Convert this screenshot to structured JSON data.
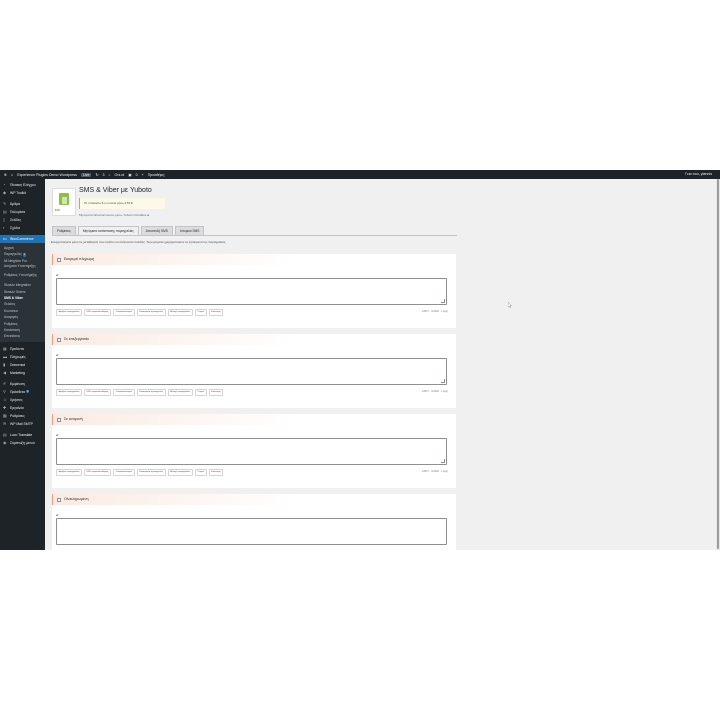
{
  "adminbar": {
    "site_name": "Experience Plugins Demo Wordpress",
    "site_badge": "Live",
    "updates_count": "3",
    "clear_label": "Οτε.ιά",
    "comments_count": "0",
    "new_label": "Προσθήκη",
    "greeting": "Γεια σου, yiannis"
  },
  "sidebar": {
    "top_items": [
      {
        "label": "Πίνακας Ελέγχου",
        "icon": "dashboard-icon"
      },
      {
        "label": "WP Toolkit",
        "icon": "toolkit-icon"
      }
    ],
    "content_items": [
      {
        "label": "Άρθρα",
        "icon": "pin-icon"
      },
      {
        "label": "Πολυμέσα",
        "icon": "media-icon"
      },
      {
        "label": "Σελίδες",
        "icon": "pages-icon"
      },
      {
        "label": "Σχόλια",
        "icon": "comments-icon"
      }
    ],
    "woocommerce_label": "WooCommerce",
    "woo_sub": [
      {
        "label": "Αρχική",
        "current": false
      },
      {
        "label": "Παραγγελίες",
        "badge": "1",
        "current": false
      },
      {
        "label": "Mi Neighbor Pro",
        "current": false
      },
      {
        "label": "Αιτήματα Υποστήριξης",
        "current": false
      },
      {
        "label": "Ρυθμίσεις Υποστήριξης",
        "current": false
      },
      {
        "label": "Skroutz Integration",
        "current": false
      },
      {
        "label": "Skroutz Orders",
        "current": false
      },
      {
        "label": "SMS & Viber",
        "current": true
      },
      {
        "label": "Πελάτες",
        "current": false
      },
      {
        "label": "Κουπόνια",
        "current": false
      },
      {
        "label": "Αναφορές",
        "current": false
      },
      {
        "label": "Ρυθμίσεις",
        "current": false
      },
      {
        "label": "Κατάσταση",
        "current": false
      },
      {
        "label": "Επεκτάσεις",
        "current": false
      }
    ],
    "shop_items": [
      {
        "label": "Προϊόντα",
        "icon": "products-icon"
      },
      {
        "label": "Πληρωμές",
        "icon": "payments-icon"
      },
      {
        "label": "Στατιστικά",
        "icon": "analytics-icon"
      },
      {
        "label": "Marketing",
        "icon": "megaphone-icon"
      }
    ],
    "tool_items": [
      {
        "label": "Εμφάνιση",
        "icon": "brush-icon"
      },
      {
        "label": "Πρόσθετα",
        "icon": "plugin-icon",
        "badge": "3"
      },
      {
        "label": "Χρήστες",
        "icon": "users-icon"
      },
      {
        "label": "Εργαλεία",
        "icon": "wrench-icon"
      },
      {
        "label": "Ρυθμίσεις",
        "icon": "settings-icon"
      },
      {
        "label": "WP Mail SMTP",
        "icon": "mail-icon"
      }
    ],
    "bottom_items": [
      {
        "label": "Loco Translate",
        "icon": "translate-icon"
      },
      {
        "label": "Σύμπτυξη μενού",
        "icon": "collapse-icon"
      }
    ]
  },
  "page": {
    "title": "SMS & Viber με Yuboto",
    "notice": "Το υπόλοιπο δ.ν.ευ είναι μόνο 4.53 €",
    "subtext": "Μηνύματα WooCommerce μέσω Yuboto Omni/Εra.ai",
    "logo_text": "ΕΙΚ",
    "tabs": [
      {
        "label": "Ρυθμίσεις",
        "active": false
      },
      {
        "label": "Μηνύματα κατάστασης παραγγελίας",
        "active": true
      },
      {
        "label": "Αποστολή SMS",
        "active": false
      },
      {
        "label": "Ιστορικό SMS",
        "active": false
      }
    ],
    "description": "Ενεργοποιήστε μόνο τις μεταβλητές που πρέπει να στέλνονται πελάτες. Τα μηνύματα χρησιμοποιούν τα ζητούμενα της παραγγελίας."
  },
  "cards": [
    {
      "label": "Εκκρεμεί πληρωμή",
      "lang": "el",
      "counter": "GSM 7 · 0/1000 · 1 μέρη"
    },
    {
      "label": "Σε επεξεργασία",
      "lang": "el",
      "counter": "GSM 7 · 0/1000 · 1 μέρη"
    },
    {
      "label": "Σε αναμονή",
      "lang": "el",
      "counter": "GSM 7 · 0/1000 · 1 μέρη"
    },
    {
      "label": "Ολοκληρωμένη",
      "lang": "el",
      "counter": ""
    }
  ],
  "placeholders": [
    "Αριθμός παραγγελίας",
    "URL παρακολούθησης",
    "Ονοματεπώνυμο",
    "Κατάσταση παραγγελίας",
    "Αλλαγή παραγγελίας",
    "Όνομα",
    "Επώνυμο"
  ],
  "colors": {
    "admin_dark": "#1d2327",
    "accent_blue": "#2271b1",
    "card_header_border": "#e59e82",
    "chip_text": "#8a2c0d"
  }
}
